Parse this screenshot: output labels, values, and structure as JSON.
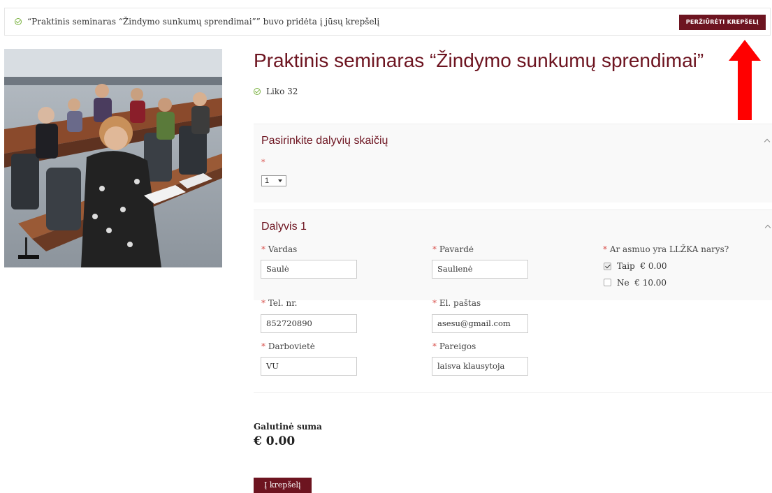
{
  "notice": {
    "message": "“Praktinis seminaras “Žindymo sunkumų sprendimai”” buvo pridėta į jūsų krepšelį",
    "button": "PERŽIŪRĖTI KREPŠELĮ"
  },
  "product": {
    "title": "Praktinis seminaras “Žindymo sunkumų sprendimai”",
    "stock": "Liko 32"
  },
  "participants": {
    "title": "Pasirinkite dalyvių skaičių",
    "required_mark": "*",
    "selected": "1"
  },
  "participant1": {
    "title": "Dalyvis 1",
    "fields": {
      "first_name": {
        "label": "Vardas",
        "value": "Saulė"
      },
      "last_name": {
        "label": "Pavardė",
        "value": "Saulienė"
      },
      "member_question": {
        "label": "Ar asmuo yra LLŽKA narys?"
      },
      "phone": {
        "label": "Tel. nr.",
        "value": "852720890"
      },
      "email": {
        "label": "El. paštas",
        "value": "asesu@gmail.com"
      },
      "workplace": {
        "label": "Darbovietė",
        "value": "VU"
      },
      "position": {
        "label": "Pareigos",
        "value": "laisva klausytoja"
      }
    },
    "options": [
      {
        "label": "Taip",
        "price": "€ 0.00",
        "checked": true
      },
      {
        "label": "Ne",
        "price": "€ 10.00",
        "checked": false
      }
    ]
  },
  "total": {
    "label": "Galutinė suma",
    "value": "€ 0.00"
  },
  "add_to_cart": "Į krepšelį",
  "colors": {
    "accent": "#6d1420",
    "success": "#7cb342",
    "annotation": "#ff0000"
  }
}
